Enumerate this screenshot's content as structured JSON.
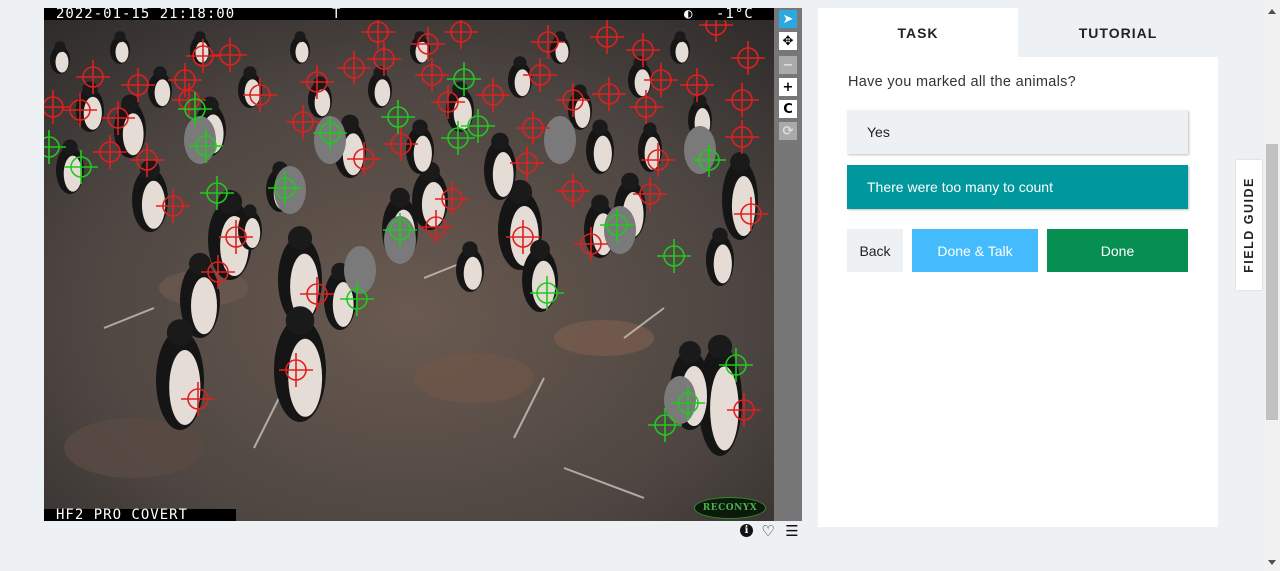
{
  "camera": {
    "timestamp": "2022-01-15 21:18:00",
    "camera_letter": "T",
    "moon_icon": "moon-phase-icon",
    "temperature": "-1°C",
    "model": "HF2 PRO COVERT",
    "logo_text": "RECONYX"
  },
  "toolbar": {
    "tools": [
      "pointer-icon",
      "move-icon",
      "zoom-out-icon",
      "zoom-in-icon",
      "rotate-icon",
      "reset-icon"
    ],
    "glyphs": {
      "pointer": "➤",
      "move": "✥",
      "zoom_out": "−",
      "zoom_in": "+",
      "rotate": "C",
      "reset": "⟳"
    }
  },
  "meta_icons": {
    "info": "i",
    "favorite": "♡",
    "collections": "☰"
  },
  "task_panel": {
    "tabs": [
      {
        "label": "TASK",
        "active": true
      },
      {
        "label": "TUTORIAL",
        "active": false
      }
    ],
    "question": "Have you marked all the animals?",
    "answers": [
      {
        "label": "Yes",
        "selected": false
      },
      {
        "label": "There were too many to count",
        "selected": true
      }
    ],
    "buttons": {
      "back": "Back",
      "done_talk": "Done & Talk",
      "done": "Done"
    }
  },
  "field_guide": {
    "label": "FIELD GUIDE"
  },
  "colors": {
    "marker_red": "#e02020",
    "marker_green": "#22c822",
    "teal": "#00979d",
    "light_blue": "#43bbfd",
    "green": "#078f52",
    "tool_active": "#2aa8e0"
  },
  "markers": {
    "red_count": 54,
    "green_count": 19
  }
}
